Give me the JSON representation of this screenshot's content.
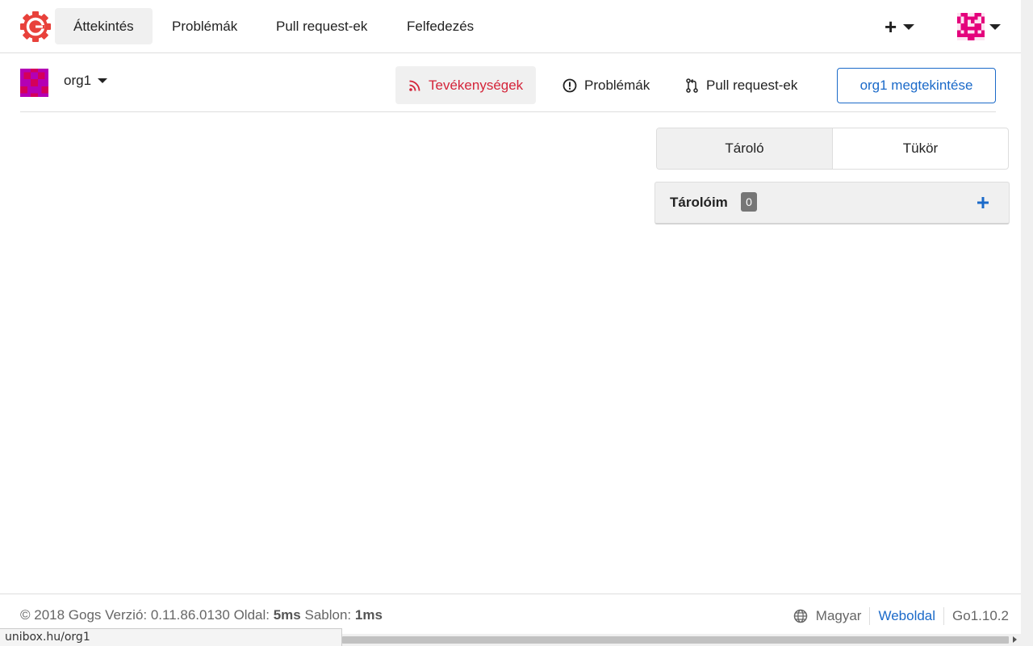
{
  "navbar": {
    "items": [
      {
        "label": "Áttekintés",
        "active": true
      },
      {
        "label": "Problémák"
      },
      {
        "label": "Pull request-ek"
      },
      {
        "label": "Felfedezés"
      }
    ],
    "create_label": "+"
  },
  "org": {
    "name": "org1",
    "tabs": [
      {
        "label": "Tevékenységek",
        "icon": "rss-icon",
        "active": true
      },
      {
        "label": "Problémák",
        "icon": "issue-icon"
      },
      {
        "label": "Pull request-ek",
        "icon": "pull-request-icon"
      }
    ],
    "view_button": "org1 megtekintése"
  },
  "repos": {
    "segments": [
      {
        "label": "Tároló",
        "active": true
      },
      {
        "label": "Tükör"
      }
    ],
    "title": "Tárolóim",
    "count": "0"
  },
  "footer": {
    "copyright": "© 2018 Gogs Verzió: 0.11.86.0130 Oldal:",
    "page_time": "5ms",
    "template_label": "Sablon:",
    "template_time": "1ms",
    "language": "Magyar",
    "website": "Weboldal",
    "go_version": "Go1.10.2"
  },
  "status": {
    "url": "unibox.hu/org1"
  },
  "colors": {
    "accent_red": "#d42439",
    "link_blue": "#1b6ac9",
    "avatar_magenta": "#e4007c"
  }
}
